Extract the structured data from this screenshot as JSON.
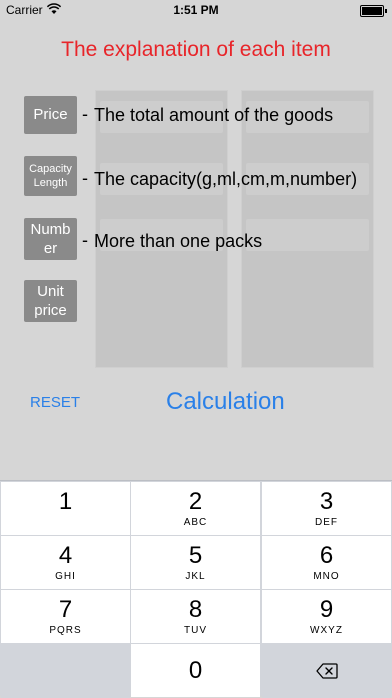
{
  "status_bar": {
    "carrier": "Carrier",
    "time": "1:51 PM"
  },
  "title": "The explanation of each item",
  "items": [
    {
      "label_lines": [
        "Price"
      ],
      "explanation": "The total amount of the goods"
    },
    {
      "label_lines": [
        "Capacity",
        "Length"
      ],
      "explanation": "The capacity(g,ml,cm,m,number)"
    },
    {
      "label_lines": [
        "Numb",
        "er"
      ],
      "explanation": "More than one packs"
    },
    {
      "label_lines": [
        "Unit",
        "price"
      ],
      "explanation": ""
    }
  ],
  "dash": "-",
  "buttons": {
    "reset": "RESET",
    "calculation": "Calculation"
  },
  "keyboard": {
    "keys": [
      {
        "n": "1",
        "l": ""
      },
      {
        "n": "2",
        "l": "ABC"
      },
      {
        "n": "3",
        "l": "DEF"
      },
      {
        "n": "4",
        "l": "GHI"
      },
      {
        "n": "5",
        "l": "JKL"
      },
      {
        "n": "6",
        "l": "MNO"
      },
      {
        "n": "7",
        "l": "PQRS"
      },
      {
        "n": "8",
        "l": "TUV"
      },
      {
        "n": "9",
        "l": "WXYZ"
      },
      {
        "n": "0",
        "l": ""
      }
    ]
  },
  "colors": {
    "title": "#e8252a",
    "accent": "#2a80e8",
    "label_bg": "#8a8a8a"
  },
  "icons": {
    "wifi": "wifi-icon",
    "battery": "battery-icon",
    "delete": "delete-backspace-icon"
  }
}
